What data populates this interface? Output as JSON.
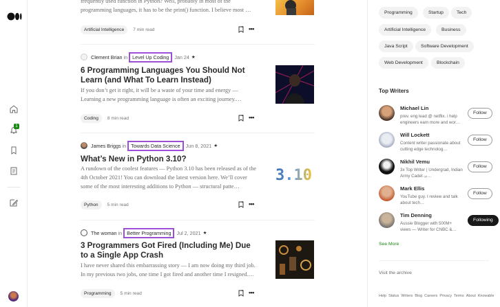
{
  "nav": {
    "logo": "medium-logo",
    "icons": [
      "home-icon",
      "notifications-icon",
      "lists-icon",
      "stories-icon",
      "write-icon"
    ],
    "notification_count": "1"
  },
  "articles": [
    {
      "subtitle": "frequently used function in Python? Well, probably in most of the programming languages, it has to be the print() function. I believe most …",
      "tag": "Artificial Intelligence",
      "read_time": "7 min read"
    },
    {
      "author": "Clement Brian",
      "in": "in",
      "publication": "Level Up Coding",
      "date": "Jan 24",
      "title": "6 Programming Languages You Should Not Learn (and What To Learn Instead)",
      "subtitle": "If you don’t get it right, it will be a waste of your time and energy — Learning a new programming language is often an exciting journey.…",
      "tag": "Coding",
      "read_time": "8 min read"
    },
    {
      "author": "James Briggs",
      "in": "in",
      "publication": "Towards Data Science",
      "date": "Jun 8, 2021",
      "title": "What’s New in Python 3.10?",
      "subtitle": "A rundown of the coolest features — Python 3.10 has been released as of the 4th October 2021! You can download the latest version here. We’ll cover some of the most interesting additions to Python — structural patte…",
      "tag": "Python",
      "read_time": "5 min read",
      "thumb_text": "3.10"
    },
    {
      "author": "The woman",
      "in": "in",
      "publication": "Better Programming",
      "date": "Jul 2, 2021",
      "title": "3 Programmers Got Fired (Including Me) Due to a Single App Crash",
      "subtitle": "I have never shared this embarrassing story — I am now doing my third job. In my previous two jobs, one time I got fired and another time I resigned.…",
      "tag": "Programming",
      "read_time": "5 min read"
    }
  ],
  "sidebar": {
    "topics": [
      "Programming",
      "Startup",
      "Tech",
      "Artificial Intelligence",
      "Business",
      "Java Script",
      "Software Development",
      "Web Development",
      "Blockchain"
    ],
    "top_writers_heading": "Top Writers",
    "writers": [
      {
        "name": "Michael Lin",
        "bio": "prev. eng lead @ netflix. i help engineers earn more and wor…",
        "follow": "Follow"
      },
      {
        "name": "Will Lockett",
        "bio": "Content writer passionate about cutting edge technolog…",
        "follow": "Follow"
      },
      {
        "name": "Nikhil Vemu",
        "bio": "3x Top Writer | Undergrad, Indian Army Cadet ₍ₒₗ…",
        "follow": "Follow"
      },
      {
        "name": "Mark Ellis",
        "bio": "YouTube guy. I review and talk about tech…",
        "follow": "Follow"
      },
      {
        "name": "Tim Denning",
        "bio": "Aussie Blogger with 500M+ views — Writer for CNBC &…",
        "follow": "Following"
      }
    ],
    "see_more": "See More",
    "archive": "Visit the archive",
    "footer_links": [
      "Help",
      "Status",
      "Writers",
      "Blog",
      "Careers",
      "Privacy",
      "Terms",
      "About",
      "Knowable"
    ]
  },
  "colors": {
    "highlight_box": "#9b4ed8",
    "accent_green": "#1a8917"
  }
}
